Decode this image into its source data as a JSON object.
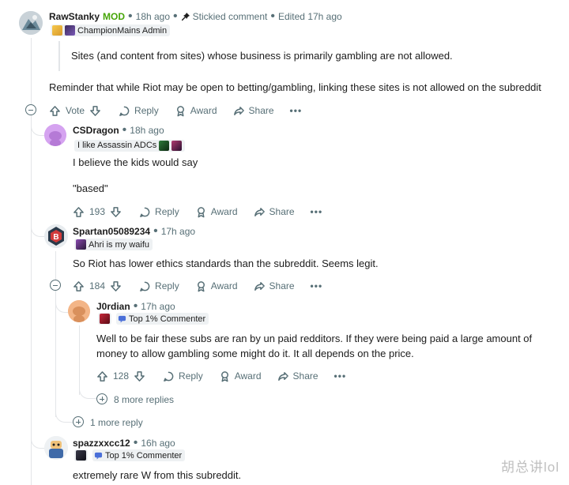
{
  "colors": {
    "mod": "#46a508",
    "meta": "#576f76",
    "thread_line": "#e3e5e8",
    "flair_bg": "#eef1f3"
  },
  "comments": [
    {
      "username": "RawStanky",
      "mod_badge": "MOD",
      "time": "18h ago",
      "pin_icon": "pin-icon",
      "stickied": "Stickied comment",
      "edited": "Edited 17h ago",
      "flair": "ChampionMains Admin",
      "quote": "Sites (and content from sites) whose business is primarily gambling are not allowed.",
      "body": "Reminder that while Riot may be open to betting/gambling, linking these sites is not allowed on the subreddit",
      "vote_label": "Vote",
      "reply": "Reply",
      "award": "Award",
      "share": "Share",
      "more": "•••"
    },
    {
      "username": "CSDragon",
      "time": "18h ago",
      "flair": "I like Assassin ADCs",
      "body_lines": [
        "I believe the kids would say",
        "\"based\""
      ],
      "votes": "193",
      "reply": "Reply",
      "award": "Award",
      "share": "Share",
      "more": "•••"
    },
    {
      "username": "Spartan05089234",
      "time": "17h ago",
      "flair": "Ahri is my waifu",
      "body": "So Riot has lower ethics standards than the subreddit. Seems legit.",
      "votes": "184",
      "reply": "Reply",
      "award": "Award",
      "share": "Share",
      "more": "•••"
    },
    {
      "username": "J0rdian",
      "time": "17h ago",
      "flair": "Top 1% Commenter",
      "body_lines": [
        "Well to be fair these subs are ran by un paid redditors. If they were being paid a large amount of",
        "money to allow gambling some might do it. It all depends on the price."
      ],
      "votes": "128",
      "reply": "Reply",
      "award": "Award",
      "share": "Share",
      "more": "•••",
      "more_replies": "8 more replies"
    },
    {
      "username": "spazzxxcc12",
      "time": "16h ago",
      "flair": "Top 1% Commenter",
      "body": "extremely rare W from this subreddit."
    }
  ],
  "spartan_more_reply": "1 more reply",
  "watermark": "胡总讲lol"
}
